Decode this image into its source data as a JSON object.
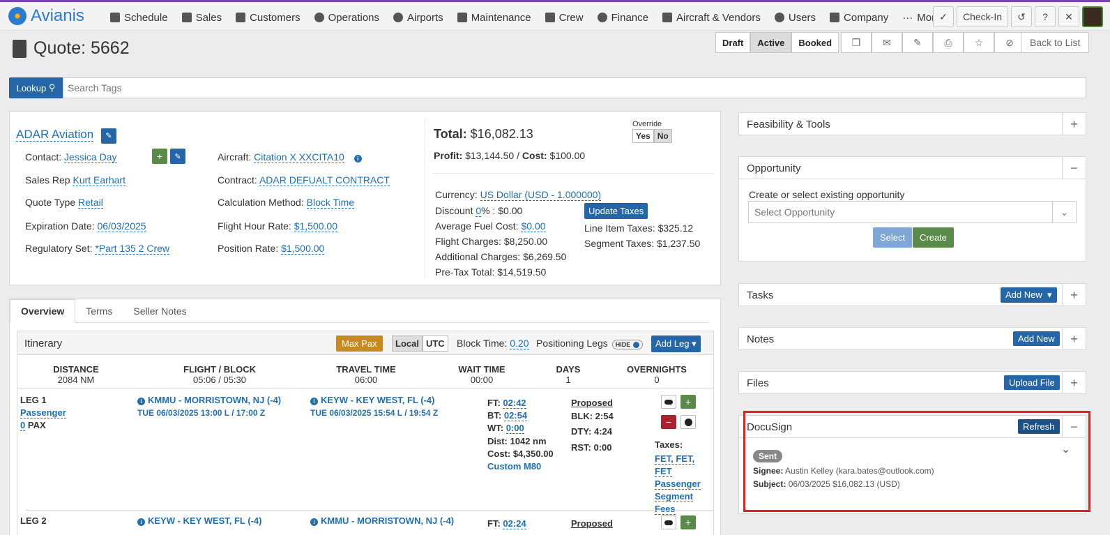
{
  "app": {
    "name": "Avianis"
  },
  "nav": [
    "Schedule",
    "Sales",
    "Customers",
    "Operations",
    "Airports",
    "Maintenance",
    "Crew",
    "Finance",
    "Aircraft & Vendors",
    "Users",
    "Company",
    "More"
  ],
  "topbar": {
    "checkin": "Check-In"
  },
  "page": {
    "title": "Quote: 5662"
  },
  "status": {
    "draft": "Draft",
    "active": "Active",
    "booked": "Booked"
  },
  "back": "Back to List",
  "lookup": {
    "label": "Lookup",
    "placeholder": "Search Tags"
  },
  "quote": {
    "company": "ADAR Aviation",
    "contact_label": "Contact:",
    "contact": "Jessica Day",
    "salesrep_label": "Sales Rep",
    "salesrep": "Kurt Earhart",
    "quotetype_label": "Quote Type",
    "quotetype": "Retail",
    "expiration_label": "Expiration Date:",
    "expiration": "06/03/2025",
    "regset_label": "Regulatory Set:",
    "regset": "*Part 135 2 Crew",
    "aircraft_label": "Aircraft:",
    "aircraft": "Citation X XXCITA10",
    "contract_label": "Contract:",
    "contract": "ADAR DEFUALT CONTRACT",
    "calc_label": "Calculation Method:",
    "calc": "Block Time",
    "fhr_label": "Flight Hour Rate:",
    "fhr": "$1,500.00",
    "pos_label": "Position Rate:",
    "pos": "$1,500.00"
  },
  "totals": {
    "total_label": "Total:",
    "total": "$16,082.13",
    "profit_label": "Profit:",
    "profit": "$13,144.50",
    "cost_label": "Cost:",
    "cost": "$100.00",
    "override": "Override",
    "yes": "Yes",
    "no": "No",
    "currency_label": "Currency:",
    "currency": "US Dollar (USD - 1.000000)",
    "discount_label": "Discount",
    "discount_pct": "0",
    "discount_val": "% : $0.00",
    "fuel_label": "Average Fuel Cost:",
    "fuel": "$0.00",
    "flight_charges": "Flight Charges: $8,250.00",
    "additional": "Additional Charges: $6,269.50",
    "pretax": "Pre-Tax Total: $14,519.50",
    "update_taxes": "Update Taxes",
    "line_taxes": "Line Item Taxes: $325.12",
    "segment_taxes": "Segment Taxes: $1,237.50"
  },
  "tabs": [
    "Overview",
    "Terms",
    "Seller Notes"
  ],
  "itinerary": {
    "title": "Itinerary",
    "maxpax": "Max Pax",
    "local": "Local",
    "utc": "UTC",
    "block_label": "Block Time:",
    "block": "0.20",
    "positioning": "Positioning Legs",
    "hide": "HIDE",
    "addleg": "Add Leg",
    "stats": [
      {
        "h": "DISTANCE",
        "v": "2084 NM"
      },
      {
        "h": "FLIGHT / BLOCK",
        "v": "05:06 / 05:30"
      },
      {
        "h": "TRAVEL TIME",
        "v": "06:00"
      },
      {
        "h": "WAIT TIME",
        "v": "00:00"
      },
      {
        "h": "DAYS",
        "v": "1"
      },
      {
        "h": "OVERNIGHTS",
        "v": "0"
      }
    ],
    "leg1": {
      "name": "LEG 1",
      "type": "Passenger",
      "pax_n": "0",
      "pax": "PAX",
      "from": "KMMU - MORRISTOWN, NJ (-4)",
      "from_time": "TUE 06/03/2025 13:00 L / 17:00 Z",
      "to": "KEYW - KEY WEST, FL (-4)",
      "to_time": "TUE 06/03/2025 15:54 L / 19:54 Z",
      "ft_label": "FT:",
      "ft": "02:42",
      "bt_label": "BT:",
      "bt": "02:54",
      "wt_label": "WT:",
      "wt": "0:00",
      "dist": "Dist: 1042 nm",
      "cost": "Cost: $4,350.00",
      "custom": "Custom M80",
      "proposed": "Proposed",
      "blk": "BLK: 2:54",
      "dty": "DTY: 4:24",
      "rst": "RST: 0:00",
      "taxes_label": "Taxes:",
      "taxes": "FET, FET, FET",
      "taxes2": "Passenger Segment Fees"
    },
    "leg2": {
      "name": "LEG 2",
      "from": "KEYW - KEY WEST, FL (-4)",
      "to": "KMMU - MORRISTOWN, NJ (-4)",
      "ft_label": "FT:",
      "ft": "02:24",
      "proposed": "Proposed"
    }
  },
  "panels": {
    "feasibility": "Feasibility & Tools",
    "opportunity": "Opportunity",
    "opp_label": "Create or select existing opportunity",
    "opp_placeholder": "Select Opportunity",
    "select": "Select",
    "create": "Create",
    "tasks": "Tasks",
    "add_new": "Add New",
    "notes": "Notes",
    "files": "Files",
    "upload": "Upload File",
    "docusign": "DocuSign",
    "refresh": "Refresh",
    "sent": "Sent",
    "signee_label": "Signee:",
    "signee": "Austin Kelley (kara.bates@outlook.com)",
    "subject_label": "Subject:",
    "subject": "06/03/2025 $16,082.13 (USD)"
  }
}
